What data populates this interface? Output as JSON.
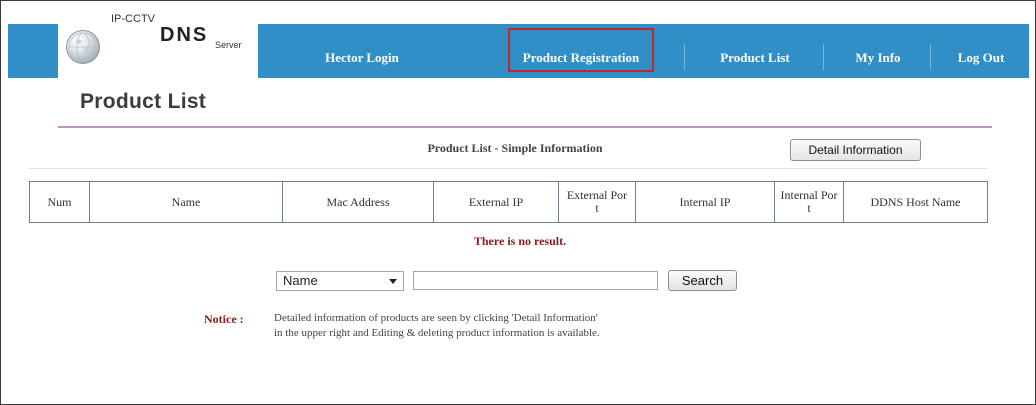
{
  "logo": {
    "top_text": "IP-CCTV",
    "main_text": "DNS",
    "sub_text": "Server"
  },
  "nav": {
    "items": [
      {
        "label": "Hector Login"
      },
      {
        "label": "Product Registration"
      },
      {
        "label": "Product List"
      },
      {
        "label": "My Info"
      },
      {
        "label": "Log Out"
      }
    ],
    "highlight_color": "#c4252a",
    "bar_color": "#2f8fc6"
  },
  "page": {
    "title": "Product List",
    "subtitle": "Product List - Simple Information",
    "detail_button": "Detail Information",
    "rule_color": "#c28ec8"
  },
  "table": {
    "columns": [
      {
        "line1": "Num",
        "line2": ""
      },
      {
        "line1": "Name",
        "line2": ""
      },
      {
        "line1": "Mac Address",
        "line2": ""
      },
      {
        "line1": "External IP",
        "line2": ""
      },
      {
        "line1": "External Por",
        "line2": "t"
      },
      {
        "line1": "Internal IP",
        "line2": ""
      },
      {
        "line1": "Internal Por",
        "line2": "t"
      },
      {
        "line1": "DDNS Host Name",
        "line2": ""
      }
    ],
    "empty_message": "There is no result."
  },
  "search": {
    "select_value": "Name",
    "input_value": "",
    "button_label": "Search"
  },
  "notice": {
    "label": "Notice :",
    "line1": "Detailed information of products are seen by clicking 'Detail Information'",
    "line2": "in the upper right and Editing & deleting product information is available."
  }
}
